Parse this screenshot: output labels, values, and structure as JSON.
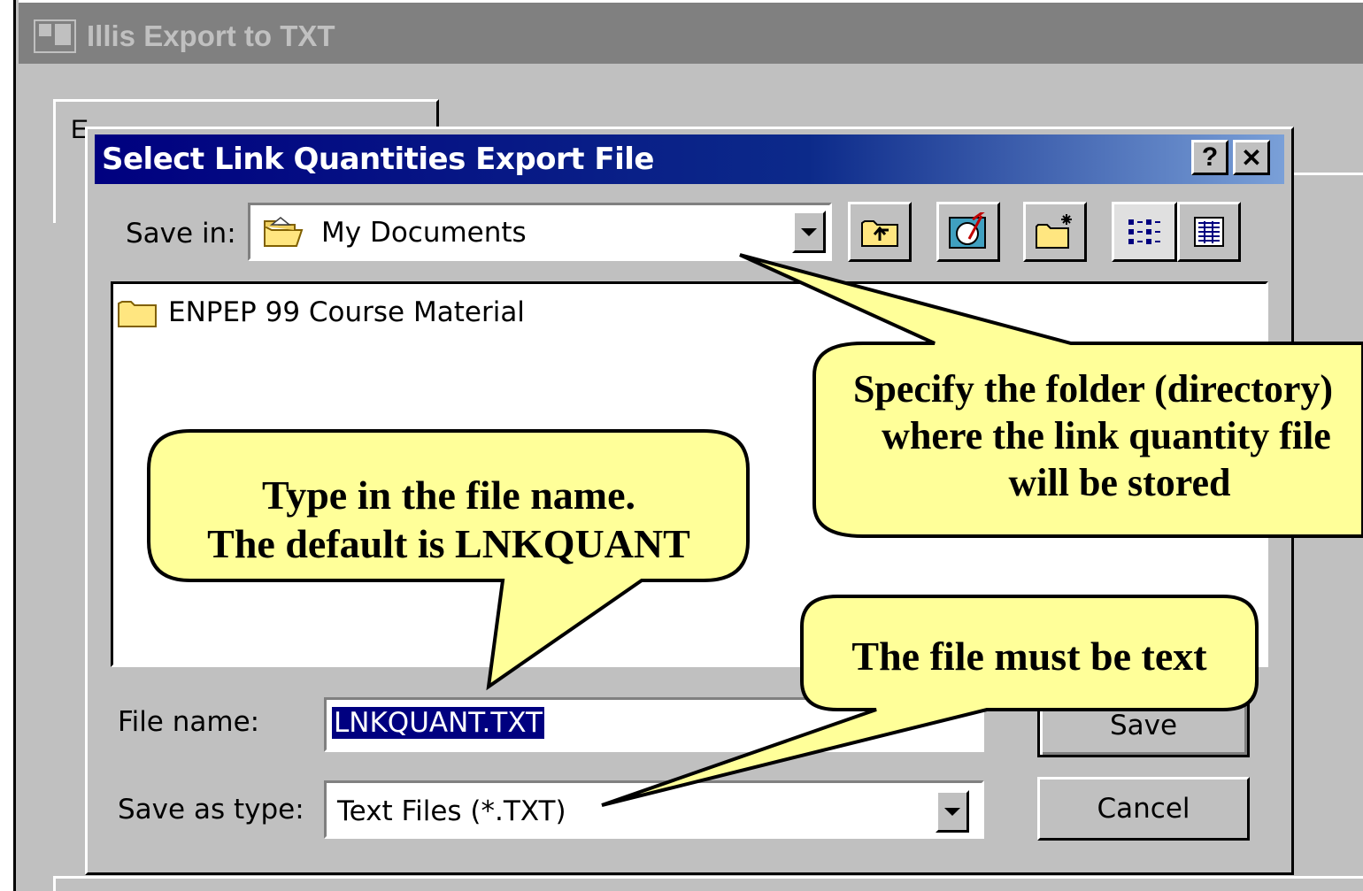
{
  "outer_window": {
    "title": "Illis Export to TXT",
    "tab_label": "E"
  },
  "dialog": {
    "title": "Select Link Quantities Export File",
    "help_button": "?",
    "close_button": "✕",
    "save_in_label": "Save in:",
    "save_in_value": "My Documents",
    "files": [
      {
        "name": "ENPEP 99 Course Material",
        "type": "folder"
      }
    ],
    "file_name_label": "File name:",
    "file_name_value": "LNKQUANT.TXT",
    "save_as_type_label": "Save as type:",
    "save_as_type_value": "Text Files (*.TXT)",
    "save_button": "Save",
    "cancel_button": "Cancel",
    "toolbar_icons": [
      "up-one-level-icon",
      "desktop-icon",
      "create-new-folder-icon",
      "list-view-icon",
      "details-view-icon"
    ]
  },
  "callouts": {
    "folder": [
      "Specify the folder (directory)",
      "where the link quantity file",
      "will be stored"
    ],
    "filename": [
      "Type in the file name.",
      "The default is LNKQUANT"
    ],
    "type": [
      "The file must be text"
    ]
  },
  "colors": {
    "title_active": "#000080",
    "face": "#c0c0c0",
    "callout_fill": "#ffff99"
  }
}
